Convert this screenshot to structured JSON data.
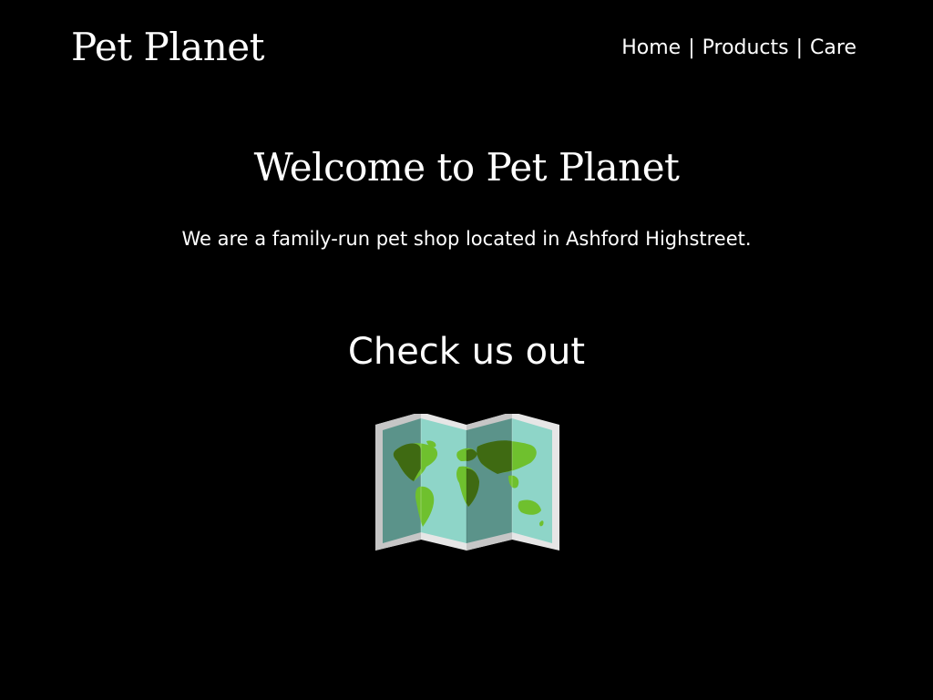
{
  "site": {
    "logo": "Pet Planet"
  },
  "nav": {
    "home": "Home",
    "products": "Products",
    "care": "Care",
    "separator": "|"
  },
  "main": {
    "heading": "Welcome to Pet Planet",
    "intro": "We are a family-run pet shop located in Ashford Highstreet.",
    "checkout_heading": "Check us out",
    "map_icon": "world-map-icon"
  },
  "colors": {
    "background": "#000000",
    "text": "#ffffff",
    "map_frame": "#e6e6e6",
    "map_water": "#8ed5c8",
    "map_water_shade": "#5b938a",
    "map_land": "#6fc02e",
    "map_land_shade": "#3f6a12"
  }
}
